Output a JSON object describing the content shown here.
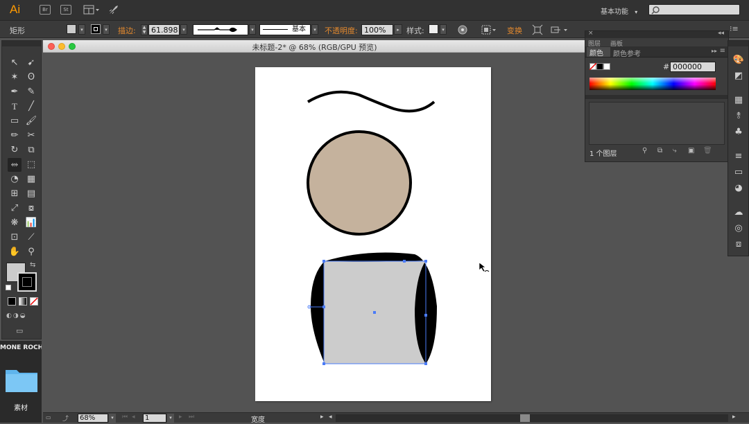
{
  "menubar": {
    "app_logo": "Ai",
    "br_label": "Br",
    "st_label": "St",
    "workspace_label": "基本功能",
    "search_placeholder": ""
  },
  "control_bar": {
    "object_type": "矩形",
    "stroke_label": "描边:",
    "stroke_value": "61.898",
    "profile_label": "基本",
    "opacity_label": "不透明度:",
    "opacity_value": "100%",
    "style_label": "样式:",
    "transform_label": "变换"
  },
  "document": {
    "title": "未标题-2* @ 68% (RGB/GPU 预览)"
  },
  "color_panel": {
    "tab_layers": "图层",
    "tab_artboards": "画板",
    "tab_color": "颜色",
    "tab_color_guide": "颜色参考",
    "hex_symbol": "#",
    "hex_value": "000000",
    "layer_count": "1 个图层"
  },
  "status_bar": {
    "zoom": "68%",
    "artboard_number": "1",
    "status_text": "宽度"
  },
  "sidebar_desktop": {
    "volume_label": "MONE ROCH",
    "folder_label": "素材"
  },
  "colors": {
    "accent_orange": "#e58a2e",
    "circle_fill": "#c5b29d",
    "rect_fill": "#cccccc",
    "selection_blue": "#4a7bf7"
  }
}
